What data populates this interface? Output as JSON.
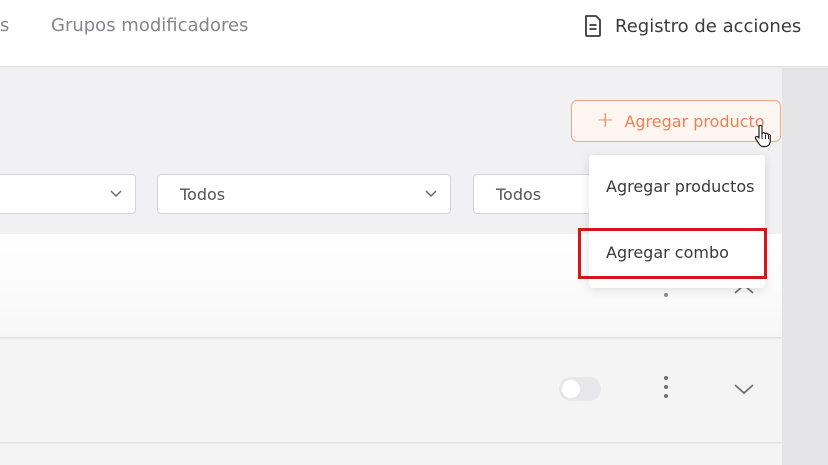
{
  "header": {
    "tab_partial": "s",
    "tab_groups": "Grupos modificadores",
    "log_label": "Registro de acciones"
  },
  "toolbar": {
    "add_product_label": "Agregar producto"
  },
  "filters": {
    "filter2_value": "Todos",
    "filter3_value": "Todos"
  },
  "dropdown": {
    "items": [
      {
        "label": "Agregar productos"
      },
      {
        "label": "Agregar combo"
      }
    ]
  },
  "icons": {
    "log": "document-icon",
    "add": "plus-icon",
    "cursor": "hand-pointer-icon",
    "chevron": "chevron-down-icon",
    "more": "kebab-icon"
  },
  "colors": {
    "accent": "#ec8052",
    "highlight": "#d4161c"
  }
}
